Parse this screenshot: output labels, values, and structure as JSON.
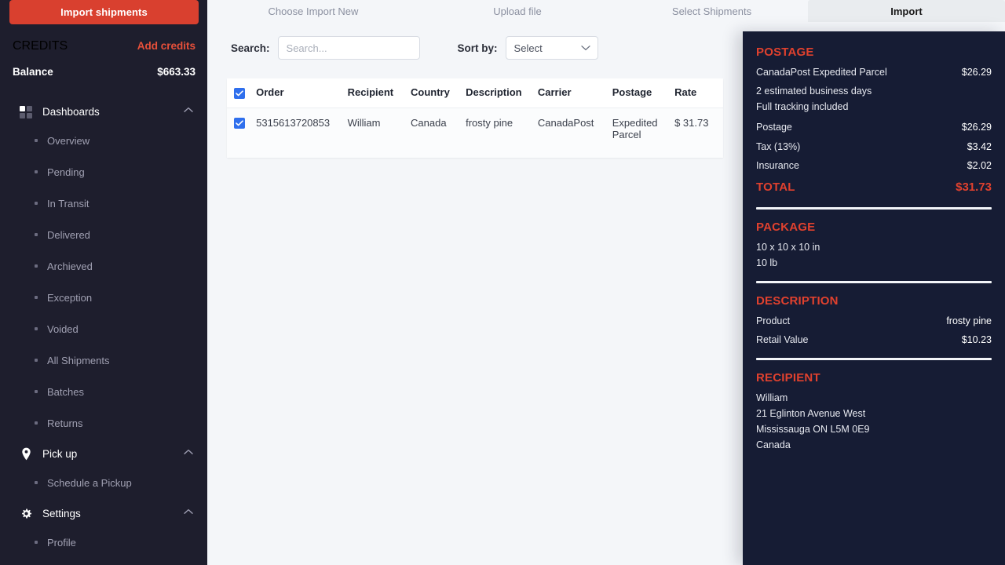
{
  "sidebar": {
    "import_button": "Import shipments",
    "credits_label": "CREDITS",
    "add_credits": "Add credits",
    "balance_label": "Balance",
    "balance_value": "$663.33",
    "groups": [
      {
        "label": "Dashboards",
        "icon": "grid-icon",
        "chevron": "⌃",
        "items": [
          "Overview",
          "Pending",
          "In Transit",
          "Delivered",
          "Archieved",
          "Exception",
          "Voided",
          "All Shipments",
          "Batches",
          "Returns"
        ]
      },
      {
        "label": "Pick up",
        "icon": "map-pin-icon",
        "chevron": "⌃",
        "items": [
          "Schedule a Pickup"
        ]
      },
      {
        "label": "Settings",
        "icon": "gear-icon",
        "chevron": "⌃",
        "items": [
          "Profile"
        ]
      }
    ]
  },
  "tabs": [
    {
      "label": "Choose Import New",
      "active": false
    },
    {
      "label": "Upload file",
      "active": false
    },
    {
      "label": "Select Shipments",
      "active": false
    },
    {
      "label": "Import",
      "active": true
    }
  ],
  "toolbar": {
    "search_label": "Search:",
    "search_value": "",
    "search_placeholder": "Search...",
    "sort_label": "Sort by:",
    "sort_selected": "Select",
    "sort_options": [
      "Select"
    ]
  },
  "table": {
    "header_checkbox_checked": true,
    "columns": [
      "Order",
      "Recipient",
      "Country",
      "Description",
      "Carrier",
      "Postage",
      "Rate"
    ],
    "rows": [
      {
        "checked": true,
        "order": "5315613720853",
        "recipient": "William",
        "country": "Canada",
        "description": "frosty pine",
        "carrier": "CanadaPost",
        "postage": "Expedited Parcel",
        "rate": "$ 31.73"
      }
    ]
  },
  "details": {
    "postage": {
      "title": "POSTAGE",
      "service_name": "CanadaPost Expedited Parcel",
      "service_price": "$26.29",
      "eta": "2 estimated business days",
      "tracking": "Full tracking included",
      "lines": [
        {
          "label": "Postage",
          "value": "$26.29"
        },
        {
          "label": "Tax (13%)",
          "value": "$3.42"
        },
        {
          "label": "Insurance",
          "value": "$2.02"
        }
      ],
      "total_label": "TOTAL",
      "total_value": "$31.73"
    },
    "package": {
      "title": "PACKAGE",
      "dimensions": "10 x 10 x 10 in",
      "weight": "10 lb"
    },
    "description": {
      "title": "DESCRIPTION",
      "lines": [
        {
          "label": "Product",
          "value": "frosty pine"
        },
        {
          "label": "Retail Value",
          "value": "$10.23"
        }
      ]
    },
    "recipient": {
      "title": "RECIPIENT",
      "lines": [
        "William",
        "21 Eglinton Avenue West",
        "Mississauga ON L5M 0E9",
        "Canada"
      ]
    }
  },
  "colors": {
    "brand_red": "#d9402f",
    "accent_red": "#e0412e",
    "sidebar_bg": "#1e1e2d",
    "panel_bg": "#161c34",
    "main_bg": "#f4f6f9",
    "checkbox_blue": "#2f6fed"
  }
}
